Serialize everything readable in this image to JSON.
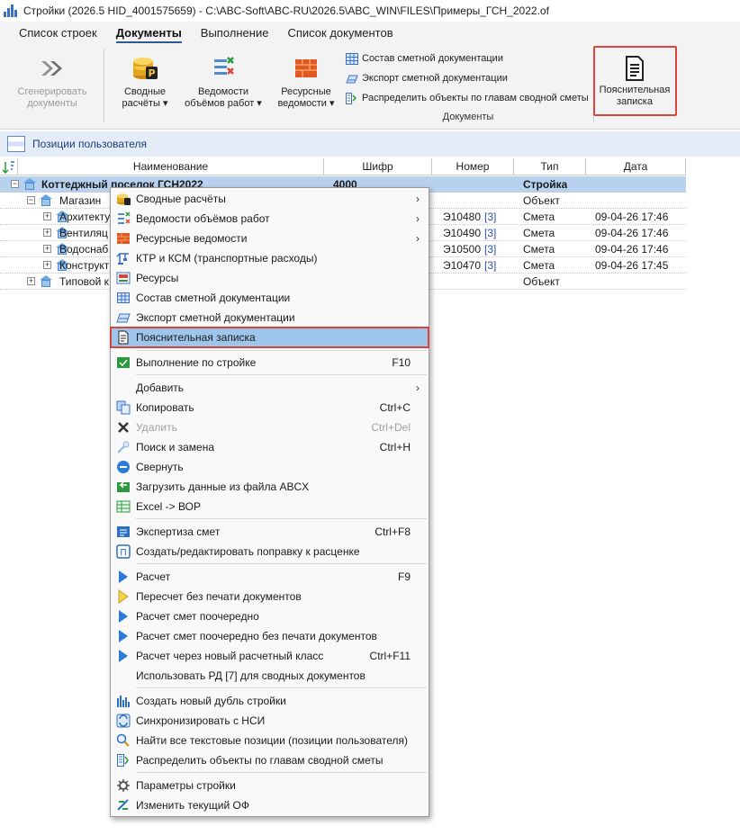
{
  "window": {
    "title": "Стройки (2026.5 HID_4001575659) - C:\\ABC-Soft\\ABC-RU\\2026.5\\ABC_WIN\\FILES\\Примеры_ГСН_2022.of"
  },
  "tabs": [
    {
      "label": "Список строек"
    },
    {
      "label": "Документы"
    },
    {
      "label": "Выполнение"
    },
    {
      "label": "Список документов"
    }
  ],
  "ribbon": {
    "generate": {
      "line1": "Сгенерировать",
      "line2": "документы"
    },
    "summary": {
      "line1": "Сводные",
      "line2": "расчёты ▾"
    },
    "volumes": {
      "line1": "Ведомости",
      "line2": "объёмов работ ▾"
    },
    "resources": {
      "line1": "Ресурсные",
      "line2": "ведомости ▾"
    },
    "small": {
      "composition": "Состав сметной документации",
      "export": "Экспорт сметной документации",
      "distribute": "Распределить объекты по главам сводной сметы"
    },
    "group_label": "Документы",
    "note": {
      "line1": "Пояснительная",
      "line2": "записка"
    }
  },
  "panel": {
    "title": "Позиции пользователя"
  },
  "grid": {
    "columns": [
      "Наименование",
      "Шифр",
      "Номер",
      "Тип",
      "Дата"
    ],
    "rows": [
      {
        "name": "Коттеджный поселок ГСН2022",
        "code": "4000",
        "number": "",
        "number_link": "",
        "type": "Стройка",
        "date": ""
      },
      {
        "name": "Магазин",
        "code": "",
        "number": "",
        "number_link": "",
        "type": "Объект",
        "date": ""
      },
      {
        "name": "Архитекту",
        "code": "",
        "number": "Э10480",
        "number_link": "[3]",
        "type": "Смета",
        "date": "09-04-26 17:46"
      },
      {
        "name": "Вентиляц",
        "code": "",
        "number": "Э10490",
        "number_link": "[3]",
        "type": "Смета",
        "date": "09-04-26 17:46"
      },
      {
        "name": "Водоснаб",
        "code": "",
        "number": "Э10500",
        "number_link": "[3]",
        "type": "Смета",
        "date": "09-04-26 17:46"
      },
      {
        "name": "Конструкт",
        "code": "",
        "number": "Э10470",
        "number_link": "[3]",
        "type": "Смета",
        "date": "09-04-26 17:45"
      },
      {
        "name": "Типовой к",
        "code": "",
        "number": "",
        "number_link": "",
        "type": "Объект",
        "date": ""
      }
    ]
  },
  "menu": {
    "items": [
      {
        "label": "Сводные расчёты",
        "key": "",
        "arrow": "›"
      },
      {
        "label": "Ведомости объёмов работ",
        "key": "",
        "arrow": "›"
      },
      {
        "label": "Ресурсные ведомости",
        "key": "",
        "arrow": "›"
      },
      {
        "label": "КТР и КСМ (транспортные расходы)",
        "key": ""
      },
      {
        "label": "Ресурсы",
        "key": ""
      },
      {
        "label": "Состав сметной документации",
        "key": ""
      },
      {
        "label": "Экспорт сметной документации",
        "key": ""
      },
      {
        "label": "Пояснительная записка",
        "key": ""
      },
      {
        "label": "Выполнение по стройке",
        "key": "F10"
      },
      {
        "label": "Добавить",
        "key": "",
        "arrow": "›"
      },
      {
        "label": "Копировать",
        "key": "Ctrl+C"
      },
      {
        "label": "Удалить",
        "key": "Ctrl+Del"
      },
      {
        "label": "Поиск и замена",
        "key": "Ctrl+H"
      },
      {
        "label": "Свернуть",
        "key": ""
      },
      {
        "label": "Загрузить данные из файла ABCX",
        "key": ""
      },
      {
        "label": "Excel -> ВОР",
        "key": ""
      },
      {
        "label": "Экспертиза смет",
        "key": "Ctrl+F8"
      },
      {
        "label": "Создать/редактировать поправку к расценке",
        "key": ""
      },
      {
        "label": "Расчет",
        "key": "F9"
      },
      {
        "label": "Пересчет без печати документов",
        "key": ""
      },
      {
        "label": "Расчет смет поочередно",
        "key": ""
      },
      {
        "label": "Расчет смет поочередно без печати документов",
        "key": ""
      },
      {
        "label": "Расчет через новый расчетный класс",
        "key": "Ctrl+F11"
      },
      {
        "label": "Использовать РД [7] для сводных документов",
        "key": ""
      },
      {
        "label": "Создать новый дубль стройки",
        "key": ""
      },
      {
        "label": "Синхронизировать с НСИ",
        "key": ""
      },
      {
        "label": "Найти все текстовые позиции (позиции пользователя)",
        "key": ""
      },
      {
        "label": "Распределить объекты по главам сводной сметы",
        "key": ""
      },
      {
        "label": "Параметры стройки",
        "key": ""
      },
      {
        "label": "Изменить текущий ОФ",
        "key": ""
      }
    ]
  },
  "colors": {
    "accent": "#2b5797",
    "selection": "#b8d1ee",
    "highlight_border": "#d9453a",
    "menu_highlight": "#9ec6ec"
  }
}
